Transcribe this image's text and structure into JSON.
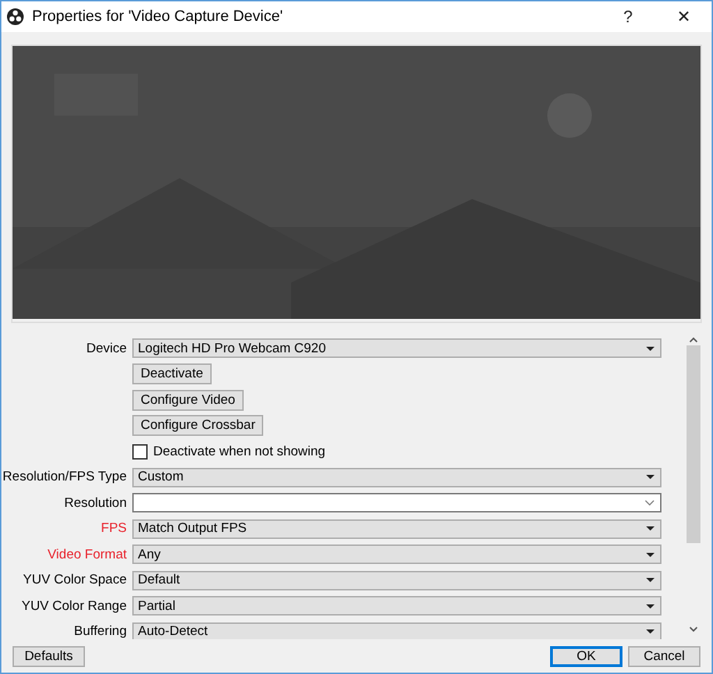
{
  "window": {
    "title": "Properties for 'Video Capture Device'",
    "help": "?",
    "close": "✕"
  },
  "properties": [
    {
      "kind": "select",
      "label": "Device",
      "value": "Logitech HD Pro Webcam C920",
      "highlighted": false
    },
    {
      "kind": "button",
      "text": "Deactivate"
    },
    {
      "kind": "button",
      "text": "Configure Video"
    },
    {
      "kind": "button",
      "text": "Configure Crossbar"
    },
    {
      "kind": "checkbox",
      "text": "Deactivate when not showing",
      "checked": false
    },
    {
      "kind": "select",
      "label": "Resolution/FPS Type",
      "value": "Custom",
      "highlighted": false
    },
    {
      "kind": "combo",
      "label": "Resolution",
      "highlighted": false
    },
    {
      "kind": "select",
      "label": "FPS",
      "value": "Match Output FPS",
      "highlighted": true
    },
    {
      "kind": "select",
      "label": "Video Format",
      "value": "Any",
      "highlighted": true
    },
    {
      "kind": "select",
      "label": "YUV Color Space",
      "value": "Default",
      "highlighted": false
    },
    {
      "kind": "select",
      "label": "YUV Color Range",
      "value": "Partial",
      "highlighted": false
    },
    {
      "kind": "select",
      "label": "Buffering",
      "value": "Auto-Detect",
      "highlighted": false
    }
  ],
  "footer": {
    "defaults": "Defaults",
    "ok": "OK",
    "cancel": "Cancel"
  }
}
